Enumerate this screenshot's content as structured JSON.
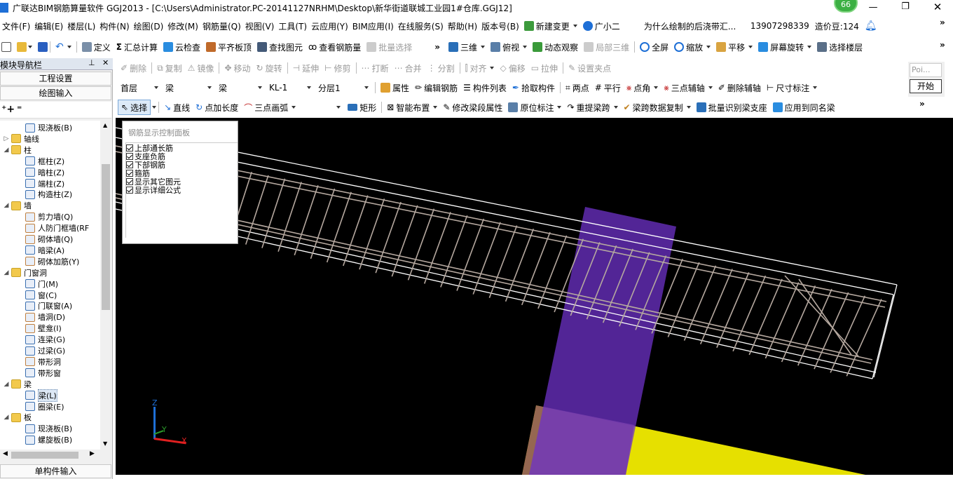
{
  "window": {
    "title": "广联达BIM钢筋算量软件 GGJ2013 - [C:\\Users\\Administrator.PC-20141127NRHM\\Desktop\\新华街道联城工业园1#仓库.GGJ12]",
    "badge": "66"
  },
  "menu": {
    "items": [
      "文件(F)",
      "编辑(E)",
      "楼层(L)",
      "构件(N)",
      "绘图(D)",
      "修改(M)",
      "钢筋量(Q)",
      "视图(V)",
      "工具(T)",
      "云应用(Y)",
      "BIM应用(I)",
      "在线服务(S)",
      "帮助(H)",
      "版本号(B)"
    ],
    "new_change": "新建变更",
    "assistant": "广小二",
    "question": "为什么绘制的后浇带汇...",
    "phone": "13907298339",
    "cost_bean": "造价豆:124"
  },
  "toolbar1": {
    "define": "定义",
    "sum": "汇总计算",
    "cloud_check": "云检查",
    "flat_top": "平齐板顶",
    "find": "查找图元",
    "view_rebar": "查看钢筋量",
    "batch_select": "批量选择",
    "three_d": "三维",
    "top_view": "俯视",
    "dyn_observe": "动态观察",
    "local_3d": "局部三维",
    "full_screen": "全屏",
    "zoom": "缩放",
    "pan": "平移",
    "screen_rotate": "屏幕旋转",
    "select_floor": "选择楼层"
  },
  "toolbar2": {
    "delete": "删除",
    "copy": "复制",
    "mirror": "镜像",
    "move": "移动",
    "rotate": "旋转",
    "extend": "延伸",
    "trim": "修剪",
    "break": "打断",
    "merge": "合并",
    "split": "分割",
    "align": "对齐",
    "offset": "偏移",
    "stretch": "拉伸",
    "set_point": "设置夹点"
  },
  "toolbar3": {
    "floor": "首层",
    "cat1": "梁",
    "cat2": "梁",
    "component": "KL-1",
    "layer": "分层1",
    "props": "属性",
    "edit_rebar": "编辑钢筋",
    "comp_list": "构件列表",
    "pick": "拾取构件",
    "two_point": "两点",
    "parallel": "平行",
    "point_angle": "点角",
    "three_point_aux": "三点辅轴",
    "del_aux": "删除辅轴",
    "dim": "尺寸标注"
  },
  "toolbar4": {
    "select": "选择",
    "line": "直线",
    "point_len": "点加长度",
    "arc3": "三点画弧",
    "rect": "矩形",
    "smart": "智能布置",
    "modify_seg": "修改梁段属性",
    "orig_mark": "原位标注",
    "re_span": "重提梁跨",
    "span_copy": "梁跨数据复制",
    "batch_support": "批量识别梁支座",
    "apply_same": "应用到同名梁"
  },
  "side_float": {
    "text": "Poi...",
    "start": "开始"
  },
  "nav": {
    "title": "模块导航栏",
    "project_settings": "工程设置",
    "drawing_input": "绘图输入",
    "single_input": "单构件输入",
    "tree": [
      {
        "label": "现浇板(B)",
        "level": 2,
        "icon": "slab"
      },
      {
        "label": "轴线",
        "level": 0,
        "icon": "folder",
        "exp": "▷"
      },
      {
        "label": "柱",
        "level": 0,
        "icon": "folder",
        "exp": "◢"
      },
      {
        "label": "框柱(Z)",
        "level": 2,
        "icon": "column"
      },
      {
        "label": "暗柱(Z)",
        "level": 2,
        "icon": "column"
      },
      {
        "label": "端柱(Z)",
        "level": 2,
        "icon": "column"
      },
      {
        "label": "构造柱(Z)",
        "level": 2,
        "icon": "column"
      },
      {
        "label": "墙",
        "level": 0,
        "icon": "folder",
        "exp": "◢"
      },
      {
        "label": "剪力墙(Q)",
        "level": 2,
        "icon": "wall"
      },
      {
        "label": "人防门框墙(RF",
        "level": 2,
        "icon": "wall"
      },
      {
        "label": "砌体墙(Q)",
        "level": 2,
        "icon": "wall"
      },
      {
        "label": "暗梁(A)",
        "level": 2,
        "icon": "beam"
      },
      {
        "label": "砌体加筋(Y)",
        "level": 2,
        "icon": "wall"
      },
      {
        "label": "门窗洞",
        "level": 0,
        "icon": "folder",
        "exp": "◢"
      },
      {
        "label": "门(M)",
        "level": 2,
        "icon": "door"
      },
      {
        "label": "窗(C)",
        "level": 2,
        "icon": "door"
      },
      {
        "label": "门联窗(A)",
        "level": 2,
        "icon": "door"
      },
      {
        "label": "墙洞(D)",
        "level": 2,
        "icon": "wall"
      },
      {
        "label": "壁龛(I)",
        "level": 2,
        "icon": "wall"
      },
      {
        "label": "连梁(G)",
        "level": 2,
        "icon": "column"
      },
      {
        "label": "过梁(G)",
        "level": 2,
        "icon": "column"
      },
      {
        "label": "带形洞",
        "level": 2,
        "icon": "wall"
      },
      {
        "label": "带形窗",
        "level": 2,
        "icon": "door"
      },
      {
        "label": "梁",
        "level": 0,
        "icon": "folder",
        "exp": "◢"
      },
      {
        "label": "梁(L)",
        "level": 2,
        "icon": "column",
        "selected": true
      },
      {
        "label": "圈梁(E)",
        "level": 2,
        "icon": "slab"
      },
      {
        "label": "板",
        "level": 0,
        "icon": "folder",
        "exp": "◢"
      },
      {
        "label": "现浇板(B)",
        "level": 2,
        "icon": "slab"
      },
      {
        "label": "螺旋板(B)",
        "level": 2,
        "icon": "beam"
      }
    ]
  },
  "rebar_panel": {
    "title": "钢筋显示控制面板",
    "options": [
      "上部通长筋",
      "支座负筋",
      "下部钢筋",
      "箍筋",
      "显示其它图元",
      "显示详细公式"
    ]
  },
  "axes": {
    "z": "Z",
    "y": "Y",
    "x": "X"
  },
  "colors": {
    "canvas": "#000000",
    "rebar": "#b5a89f",
    "column": "#6e32c8",
    "slab": "#e6e000",
    "accent": "#1e6fd6"
  }
}
